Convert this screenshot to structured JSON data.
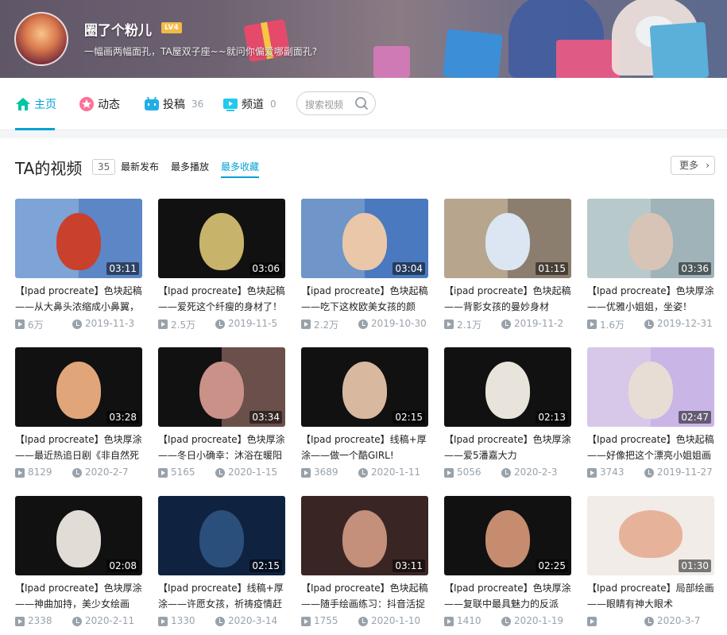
{
  "profile": {
    "username": "圈了个粉儿",
    "level": "LV4",
    "sign": "一幅画两幅面孔，TA屋双子座~~就问你偏爱哪副面孔?"
  },
  "nav": {
    "items": [
      {
        "label": "主页",
        "count": "",
        "icon": "home-icon"
      },
      {
        "label": "动态",
        "count": "",
        "icon": "dynamic-icon"
      },
      {
        "label": "投稿",
        "count": "36",
        "icon": "upload-icon"
      },
      {
        "label": "频道",
        "count": "0",
        "icon": "channel-icon"
      }
    ],
    "search_placeholder": "搜索视频"
  },
  "section": {
    "title": "TA的视频",
    "count": "35",
    "sorts": [
      "最新发布",
      "最多播放",
      "最多收藏"
    ],
    "active_sort": "最多收藏",
    "more_label": "更多"
  },
  "colors": {
    "accent": "#00a1d6",
    "meta_gray": "#99a2aa",
    "level_badge": "#f5b946"
  },
  "videos": [
    {
      "title": "【Ipad procreate】色块起稿——从大鼻头浓缩成小鼻翼，",
      "duration": "03:11",
      "views": "6万",
      "date": "2019-11-3"
    },
    {
      "title": "【Ipad procreate】色块起稿——爱死这个纤瘦的身材了！",
      "duration": "03:06",
      "views": "2.5万",
      "date": "2019-11-5"
    },
    {
      "title": "【ipad procreate】色块起稿——吃下这枚欧美女孩的颜",
      "duration": "03:04",
      "views": "2.2万",
      "date": "2019-10-30"
    },
    {
      "title": "【ipad procreate】色块起稿——背影女孩的曼妙身材",
      "duration": "01:15",
      "views": "2.1万",
      "date": "2019-11-2"
    },
    {
      "title": "【Ipad procreate】色块厚涂——优雅小姐姐，坐姿！",
      "duration": "03:36",
      "views": "1.6万",
      "date": "2019-12-31"
    },
    {
      "title": "【Ipad procreate】色块厚涂——最近热追日剧《非自然死",
      "duration": "03:28",
      "views": "8129",
      "date": "2020-2-7"
    },
    {
      "title": "【Ipad procreate】色块厚涂——冬日小确幸：沐浴在暖阳",
      "duration": "03:34",
      "views": "5165",
      "date": "2020-1-15"
    },
    {
      "title": "【Ipad procreate】线稿+厚涂——做一个酷GIRL!",
      "duration": "02:15",
      "views": "3689",
      "date": "2020-1-11"
    },
    {
      "title": "【Ipad procreate】色块厚涂——爱5潘嘉大力",
      "duration": "02:13",
      "views": "5056",
      "date": "2020-2-3"
    },
    {
      "title": "【Ipad procreate】色块起稿——好像把这个漂亮小姐姐画",
      "duration": "02:47",
      "views": "3743",
      "date": "2019-11-27"
    },
    {
      "title": "【Ipad procreate】色块厚涂——神曲加持，美少女绘画",
      "duration": "02:08",
      "views": "2338",
      "date": "2020-2-11"
    },
    {
      "title": "【Ipad procreate】线稿+厚涂——许愿女孩，祈祷疫情赶",
      "duration": "02:15",
      "views": "1330",
      "date": "2020-3-14"
    },
    {
      "title": "【Ipad procreate】色块起稿——随手绘画练习：抖音活捉",
      "duration": "03:11",
      "views": "1755",
      "date": "2020-1-10"
    },
    {
      "title": "【Ipad procreate】色块厚涂——复联中最具魅力的反派",
      "duration": "02:25",
      "views": "1410",
      "date": "2020-1-19"
    },
    {
      "title": "【Ipad procreate】局部绘画——眼睛有神大眼术",
      "duration": "01:30",
      "views": "",
      "date": "2020-3-7"
    }
  ]
}
